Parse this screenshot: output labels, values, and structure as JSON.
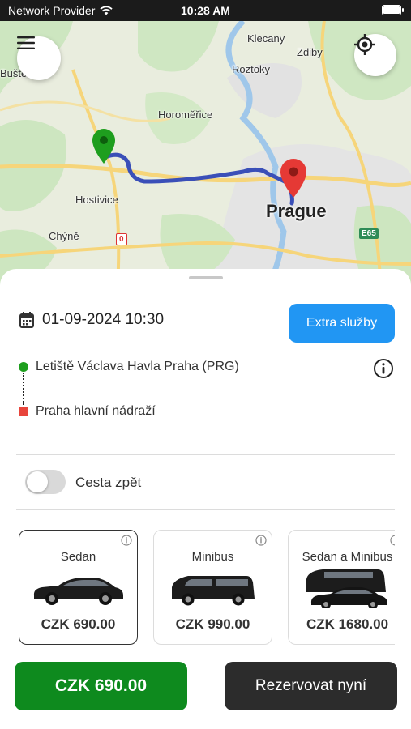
{
  "status_bar": {
    "carrier": "Network Provider",
    "time": "10:28 AM"
  },
  "map": {
    "labels": {
      "klecany": "Klecany",
      "zdiby": "Zdiby",
      "roztoky": "Roztoky",
      "bustehrad": "Buště",
      "horomerice": "Horoměřice",
      "hostivice": "Hostivice",
      "chyne": "Chýně",
      "prague": "Prague"
    },
    "road_badges": {
      "e65": "E65",
      "zero": "0"
    },
    "menu_icon": "menu-icon",
    "locate_icon": "crosshair-icon",
    "route_color": "#3a4fb8",
    "start_marker_color": "#1e9e1e",
    "end_marker_color": "#e53935"
  },
  "booking": {
    "datetime": "01-09-2024 10:30",
    "extra_services_label": "Extra služby",
    "pickup": "Letiště Václava Havla Praha (PRG)",
    "dropoff": "Praha hlavní nádraží",
    "return_trip_label": "Cesta zpět",
    "return_trip_enabled": false
  },
  "vehicles": [
    {
      "name": "Sedan",
      "price": "CZK 690.00",
      "selected": true
    },
    {
      "name": "Minibus",
      "price": "CZK 990.00",
      "selected": false
    },
    {
      "name": "Sedan a Minibus",
      "price": "CZK 1680.00",
      "selected": false
    }
  ],
  "footer": {
    "total_price": "CZK 690.00",
    "book_now_label": "Rezervovat nyní"
  },
  "colors": {
    "accent_blue": "#2196f3",
    "price_green": "#0e8a1e",
    "book_dark": "#2c2c2c"
  }
}
